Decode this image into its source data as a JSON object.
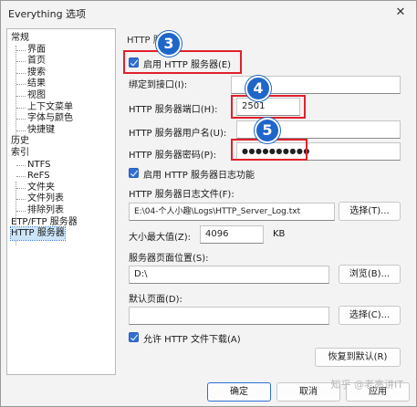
{
  "window": {
    "title": "Everything 选项",
    "close_glyph": "✕"
  },
  "tree": {
    "items": [
      {
        "label": "常规",
        "level": 0
      },
      {
        "label": "界面",
        "level": 1
      },
      {
        "label": "首页",
        "level": 1
      },
      {
        "label": "搜索",
        "level": 1
      },
      {
        "label": "结果",
        "level": 1
      },
      {
        "label": "视图",
        "level": 1
      },
      {
        "label": "上下文菜单",
        "level": 1
      },
      {
        "label": "字体与颜色",
        "level": 1
      },
      {
        "label": "快捷键",
        "level": 1
      },
      {
        "label": "历史",
        "level": 0
      },
      {
        "label": "索引",
        "level": 0
      },
      {
        "label": "NTFS",
        "level": 1
      },
      {
        "label": "ReFS",
        "level": 1
      },
      {
        "label": "文件夹",
        "level": 1
      },
      {
        "label": "文件列表",
        "level": 1
      },
      {
        "label": "排除列表",
        "level": 1
      },
      {
        "label": "ETP/FTP 服务器",
        "level": 0
      },
      {
        "label": "HTTP 服务器",
        "level": 0
      }
    ]
  },
  "panel": {
    "group_label": "HTTP 服",
    "enable_http": "启用 HTTP 服务器(E)",
    "bind_label": "绑定到接口(I):",
    "bind_value": "",
    "port_label": "HTTP 服务器端口(H):",
    "port_value": "2501",
    "user_label": "HTTP 服务器用户名(U):",
    "user_value": "",
    "password_label": "HTTP 服务器密码(P):",
    "password_value": "●●●●●●●●●●",
    "enable_log": "启用 HTTP 服务器日志功能",
    "log_file_label": "HTTP 服务器日志文件(F):",
    "log_file_value": "E:\\04-个人小趣\\Logs\\HTTP_Server_Log.txt",
    "log_browse": "选择(T)...",
    "max_size_label": "大小最大值(Z):",
    "max_size_value": "4096",
    "max_size_unit": "KB",
    "page_location_label": "服务器页面位置(S):",
    "page_location_value": "D:\\",
    "page_browse": "浏览(B)...",
    "default_page_label": "默认页面(D):",
    "default_page_value": "",
    "default_page_browse": "选择(C)...",
    "allow_download": "允许 HTTP 文件下载(A)",
    "restore_defaults": "恢复到默认(R)"
  },
  "footer": {
    "ok": "确定",
    "cancel": "取消",
    "apply": "应用"
  },
  "annotations": {
    "badge3": "3",
    "badge4": "4",
    "badge5": "5"
  },
  "watermark": "知乎 @老高讲IT",
  "colors": {
    "accent": "#2f6fd3",
    "annotation_red": "#e0212b",
    "badge_blue": "#1f66c9"
  }
}
